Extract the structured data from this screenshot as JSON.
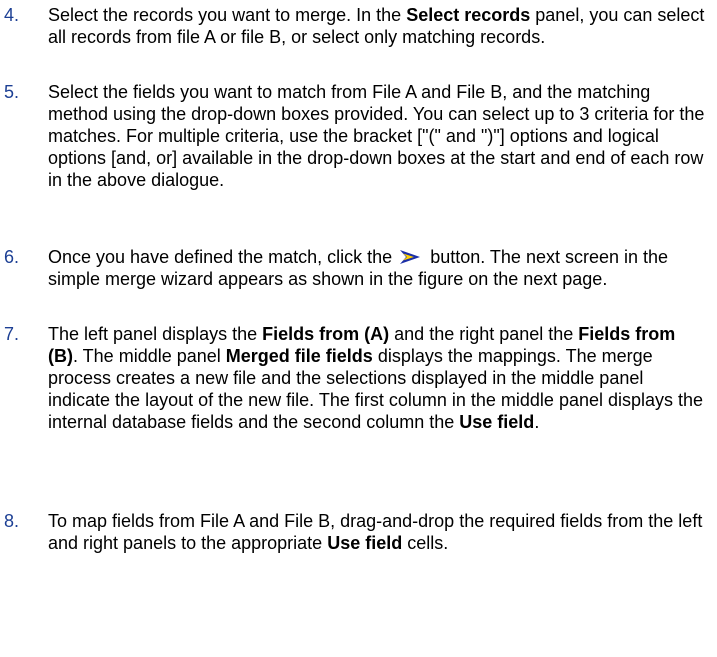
{
  "steps": [
    {
      "number": "4.",
      "parts": [
        "Select the records you want to merge. In the ",
        "Select records",
        " panel, you can select all records from file A or file B, or select only matching records."
      ]
    },
    {
      "number": "5.",
      "text": "Select the fields you want to match from File A and File B, and the matching method using the drop-down boxes provided. You can select up to 3 criteria for the matches. For multiple criteria, use the bracket [\"(\" and \")\"] options and logical options [and, or] available in the drop-down boxes at the start and end of each row in the above dialogue."
    },
    {
      "number": "6.",
      "before_icon": "Once you have defined the match, click the ",
      "icon": "next-arrow-icon",
      "after_icon": " button. The next screen in the simple merge wizard appears as shown in the figure on the next page."
    },
    {
      "number": "7.",
      "parts": [
        "The left panel displays the ",
        "Fields from (A)",
        " and the right panel the ",
        "Fields from (B)",
        ". The middle panel ",
        "Merged file fields",
        " displays the mappings. The merge process creates a new file and the selections displayed in the middle panel indicate the layout of the new file. The first column in the middle panel displays the internal database fields and the second column the ",
        "Use field",
        "."
      ]
    },
    {
      "number": "8.",
      "parts": [
        "To map fields from File A and File B, drag-and-drop the required fields from the left and right panels to the appropriate ",
        "Use field",
        " cells."
      ]
    }
  ],
  "colors": {
    "step_number": "#1c3f94",
    "icon_blue": "#1b2fa8",
    "icon_yellow": "#ffd200"
  }
}
